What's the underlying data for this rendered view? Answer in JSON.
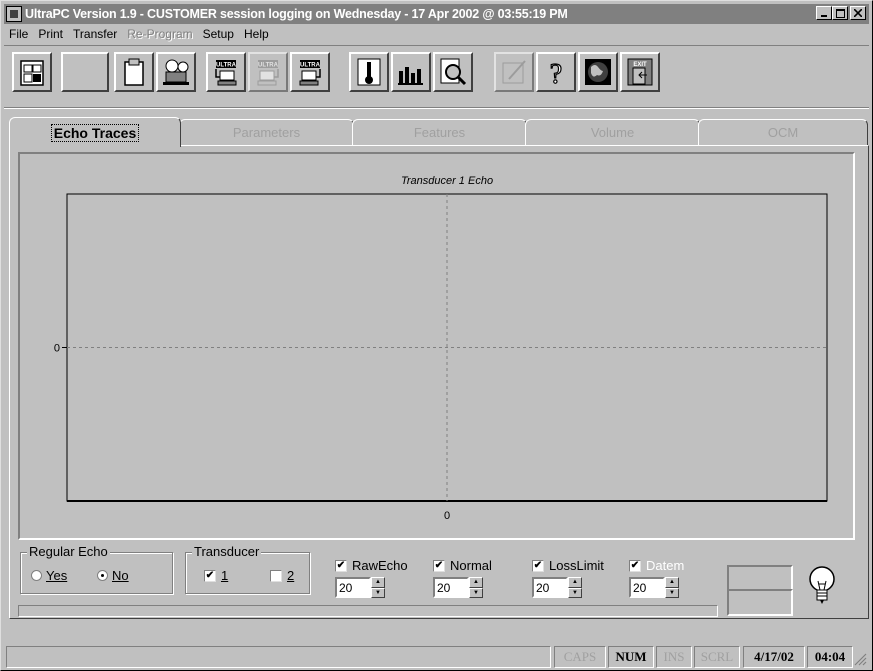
{
  "window": {
    "title": "UltraPC Version 1.9 - CUSTOMER session logging on Wednesday - 17 Apr 2002 @ 03:55:19 PM",
    "controls": {
      "minimize": "_",
      "maximize": "□",
      "close": "×"
    }
  },
  "menu": [
    {
      "label": "File",
      "enabled": true
    },
    {
      "label": "Print",
      "enabled": true
    },
    {
      "label": "Transfer",
      "enabled": true
    },
    {
      "label": "Re-Program",
      "enabled": false
    },
    {
      "label": "Setup",
      "enabled": true
    },
    {
      "label": "Help",
      "enabled": true
    }
  ],
  "toolbar": {
    "buttons": [
      {
        "icon": "filing-cabinet-icon"
      },
      {
        "icon": "blank-icon"
      },
      {
        "icon": "clipboard-icon"
      },
      {
        "icon": "projector-icon"
      },
      {
        "icon": "ultra-download-icon",
        "text": "ULTRA"
      },
      {
        "icon": "ultra-upload-icon",
        "text": "ULTRA",
        "disabled": true
      },
      {
        "icon": "ultra-transfer-icon",
        "text": "ULTRA"
      },
      {
        "icon": "thermometer-icon"
      },
      {
        "icon": "bar-graph-icon"
      },
      {
        "icon": "magnifier-doc-icon"
      },
      {
        "icon": "edit-pen-icon",
        "disabled": true
      },
      {
        "icon": "help-question-icon"
      },
      {
        "icon": "globe-icon"
      },
      {
        "icon": "exit-door-icon",
        "text": "EXIT"
      }
    ]
  },
  "tabs": [
    {
      "label": "Echo Traces",
      "active": true
    },
    {
      "label": "Parameters",
      "active": false
    },
    {
      "label": "Features",
      "active": false
    },
    {
      "label": "Volume",
      "active": false
    },
    {
      "label": "OCM",
      "active": false
    }
  ],
  "chart_data": {
    "type": "line",
    "title": "Transducer 1 Echo",
    "x_ticks": [
      "0"
    ],
    "y_ticks": [
      "0"
    ],
    "series": [],
    "grid": "dashed crosshair at 0"
  },
  "regular_echo": {
    "legend": "Regular Echo",
    "options": [
      {
        "label": "Yes",
        "accel": "Y",
        "selected": false
      },
      {
        "label": "No",
        "accel": "N",
        "selected": true
      }
    ]
  },
  "transducer": {
    "legend": "Transducer",
    "options": [
      {
        "label": "1",
        "checked": true
      },
      {
        "label": "2",
        "checked": false
      }
    ]
  },
  "traces": [
    {
      "label": "RawEcho",
      "checked": true,
      "enabled": true,
      "value": "20"
    },
    {
      "label": "Normal",
      "checked": true,
      "enabled": true,
      "value": "20"
    },
    {
      "label": "LossLimit",
      "checked": true,
      "enabled": true,
      "value": "20"
    },
    {
      "label": "Datem",
      "checked": true,
      "enabled": false,
      "value": "20"
    }
  ],
  "status": {
    "caps": "CAPS",
    "num": "NUM",
    "ins": "INS",
    "scrl": "SCRL",
    "date": "4/17/02",
    "time": "04:04"
  }
}
